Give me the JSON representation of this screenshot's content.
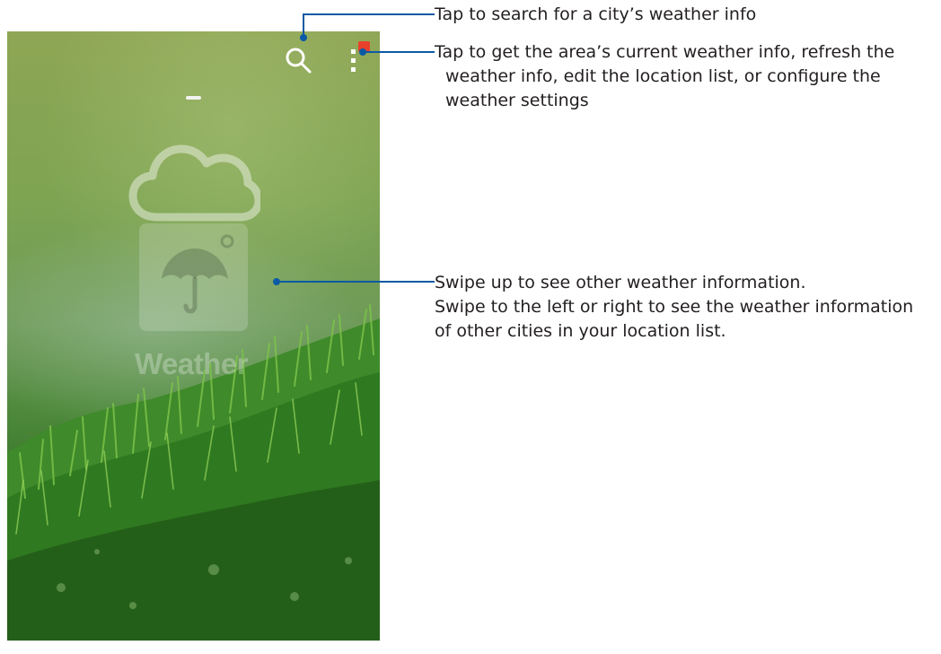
{
  "app": {
    "logo_label": "Weather"
  },
  "callouts": {
    "search": {
      "lines": [
        "Tap to search for a city’s weather info"
      ]
    },
    "menu": {
      "lines": [
        "Tap to get the area’s current weather info, refresh the",
        "weather info, edit the location list, or configure the",
        "weather settings"
      ]
    },
    "swipe": {
      "lines": [
        "Swipe up to see other weather information.",
        "Swipe to the left or right to see the weather information",
        "of other cities in your location list."
      ]
    }
  },
  "colors": {
    "callout_line": "#0b5aa4",
    "badge": "#e8402a",
    "text": "#231f20"
  },
  "icons": {
    "search": "search-icon",
    "menu": "more-vertical-icon",
    "cloud": "cloud-icon",
    "umbrella": "umbrella-icon"
  }
}
